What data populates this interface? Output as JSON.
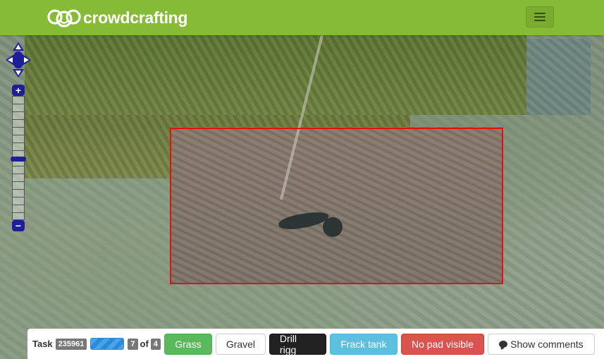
{
  "brand": {
    "name": "crowdcrafting"
  },
  "colors": {
    "navbar": "#86bb35",
    "task_box": "#e31010"
  },
  "map": {
    "controls": {
      "pan_icon": "pan-arrows-icon",
      "zoom_in": "+",
      "zoom_out": "−"
    }
  },
  "toolbar": {
    "task_label": "Task",
    "task_id": "235961",
    "progress_done": "7",
    "of_label": "of",
    "progress_total": "4",
    "buttons": {
      "grass": "Grass",
      "gravel": "Gravel",
      "drill_rigg": "Drill rigg",
      "frack_tank": "Frack tank",
      "no_pad": "No pad visible",
      "show_comments": "Show comments"
    }
  }
}
